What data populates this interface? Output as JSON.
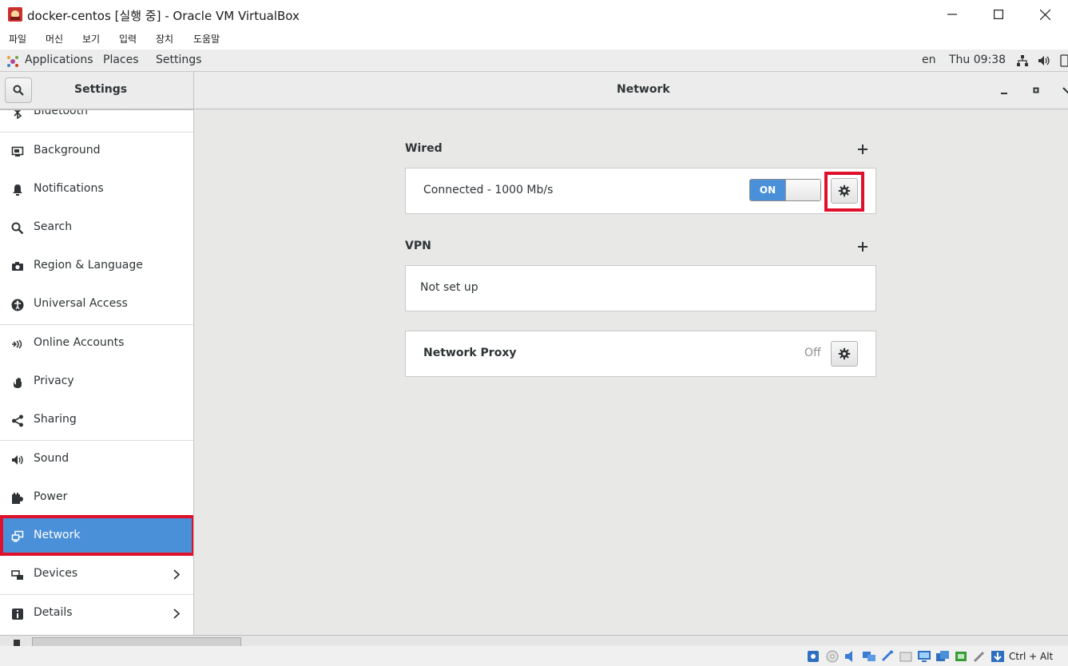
{
  "host": {
    "title": "docker-centos [실행 중] - Oracle VM VirtualBox",
    "menu": [
      "파일",
      "머신",
      "보기",
      "입력",
      "장치",
      "도움말"
    ]
  },
  "panel": {
    "applications": "Applications",
    "places": "Places",
    "settings": "Settings",
    "lang": "en",
    "clock": "Thu 09:38"
  },
  "settings": {
    "sidebar_title": "Settings",
    "page_title": "Network",
    "sidebar": [
      {
        "label": "Bluetooth",
        "icon": "bluetooth-icon"
      },
      {
        "label": "Background",
        "icon": "background-icon"
      },
      {
        "label": "Notifications",
        "icon": "bell-icon"
      },
      {
        "label": "Search",
        "icon": "search-icon"
      },
      {
        "label": "Region & Language",
        "icon": "camera-icon"
      },
      {
        "label": "Universal Access",
        "icon": "accessibility-icon"
      },
      {
        "label": "Online Accounts",
        "icon": "online-accounts-icon"
      },
      {
        "label": "Privacy",
        "icon": "hand-icon"
      },
      {
        "label": "Sharing",
        "icon": "share-icon"
      },
      {
        "label": "Sound",
        "icon": "speaker-icon"
      },
      {
        "label": "Power",
        "icon": "power-icon"
      },
      {
        "label": "Network",
        "icon": "network-icon"
      },
      {
        "label": "Devices",
        "icon": "devices-icon"
      },
      {
        "label": "Details",
        "icon": "info-icon"
      }
    ],
    "selected": "Network"
  },
  "network": {
    "wired": {
      "title": "Wired",
      "status": "Connected - 1000 Mb/s",
      "toggle": "ON"
    },
    "vpn": {
      "title": "VPN",
      "status": "Not set up"
    },
    "proxy": {
      "title": "Network Proxy",
      "state": "Off"
    }
  },
  "statusbar": {
    "host_key": "Ctrl + Alt"
  },
  "colors": {
    "accent": "#4a90d9",
    "highlight": "#e0102a"
  }
}
